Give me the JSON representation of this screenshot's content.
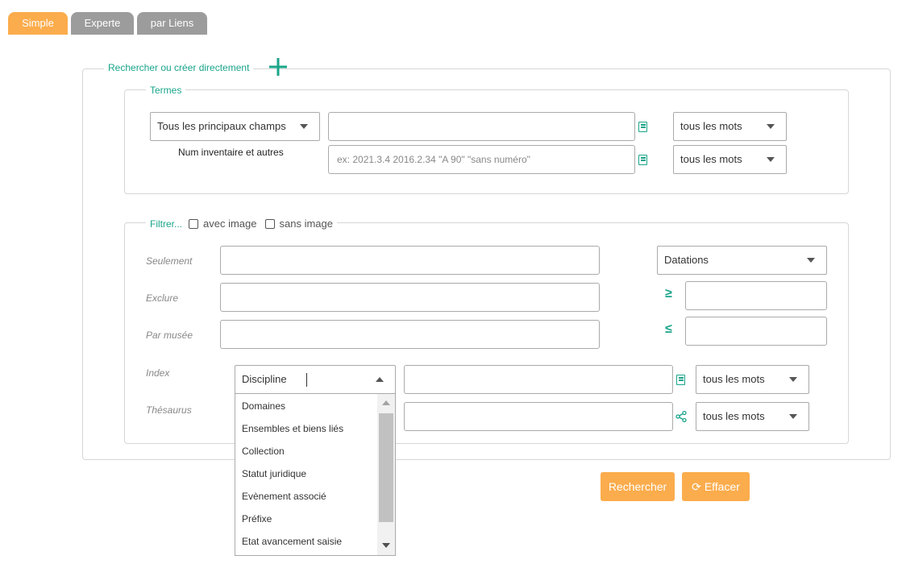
{
  "tabs": [
    {
      "label": "Simple",
      "active": true
    },
    {
      "label": "Experte",
      "active": false
    },
    {
      "label": "par Liens",
      "active": false
    }
  ],
  "search_box": {
    "legend": "Rechercher  ou créer directement",
    "add_icon": "plus-icon"
  },
  "termes": {
    "legend": "Termes",
    "field_select": "Tous les principaux champs",
    "sub_label": "Num inventaire et autres",
    "input1_value": "",
    "input2_placeholder": "ex: 2021.3.4 2016.2.34 \"A 90\" \"sans numéro\"",
    "mode1": "tous les mots",
    "mode2": "tous les mots"
  },
  "filter": {
    "legend": "Filtrer...",
    "with_image": "avec image",
    "without_image": "sans image",
    "seulement": "Seulement",
    "exclure": "Exclure",
    "par_musee": "Par  musée",
    "index": "Index",
    "thesaurus": "Thésaurus",
    "datation_select": "Datations",
    "gte": "≥",
    "lte": "≤",
    "index_select": "Discipline",
    "index_mode": "tous les mots",
    "thesaurus_mode": "tous les mots"
  },
  "dropdown_options": [
    "Domaines",
    "Ensembles et biens liés",
    "Collection",
    "Statut juridique",
    "Evènement associé",
    "Préfixe",
    "Etat avancement saisie"
  ],
  "buttons": {
    "search": "Rechercher",
    "clear": "Effacer",
    "clear_icon": "refresh-icon"
  },
  "colors": {
    "accent": "#fbac4c",
    "tab_inactive": "#9c9c9c",
    "green": "#1aa58a"
  }
}
